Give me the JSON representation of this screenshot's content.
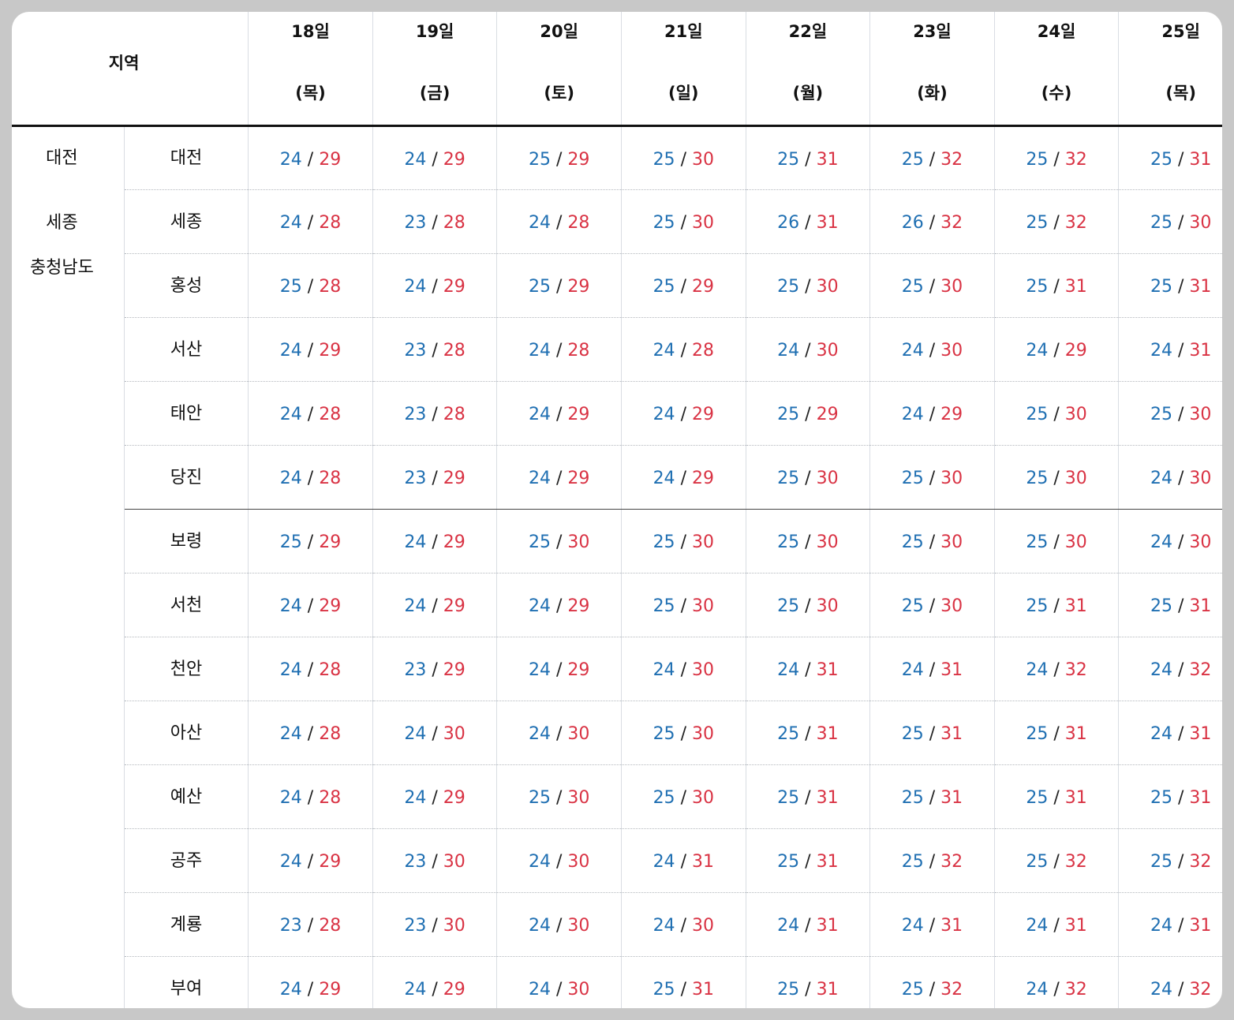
{
  "header": {
    "region_label": "지역",
    "days": [
      {
        "date": "18일",
        "dow": "(목)"
      },
      {
        "date": "19일",
        "dow": "(금)"
      },
      {
        "date": "20일",
        "dow": "(토)"
      },
      {
        "date": "21일",
        "dow": "(일)"
      },
      {
        "date": "22일",
        "dow": "(월)"
      },
      {
        "date": "23일",
        "dow": "(화)"
      },
      {
        "date": "24일",
        "dow": "(수)"
      },
      {
        "date": "25일",
        "dow": "(목)"
      }
    ]
  },
  "regions": [
    "대전",
    "세종",
    "충청남도"
  ],
  "separator": "/",
  "colors": {
    "low": "#1f6fb2",
    "high": "#d93344"
  },
  "rows": [
    {
      "city": "대전",
      "temps": [
        [
          "24",
          "29"
        ],
        [
          "24",
          "29"
        ],
        [
          "25",
          "29"
        ],
        [
          "25",
          "30"
        ],
        [
          "25",
          "31"
        ],
        [
          "25",
          "32"
        ],
        [
          "25",
          "32"
        ],
        [
          "25",
          "31"
        ]
      ]
    },
    {
      "city": "세종",
      "temps": [
        [
          "24",
          "28"
        ],
        [
          "23",
          "28"
        ],
        [
          "24",
          "28"
        ],
        [
          "25",
          "30"
        ],
        [
          "26",
          "31"
        ],
        [
          "26",
          "32"
        ],
        [
          "25",
          "32"
        ],
        [
          "25",
          "30"
        ]
      ]
    },
    {
      "city": "홍성",
      "temps": [
        [
          "25",
          "28"
        ],
        [
          "24",
          "29"
        ],
        [
          "25",
          "29"
        ],
        [
          "25",
          "29"
        ],
        [
          "25",
          "30"
        ],
        [
          "25",
          "30"
        ],
        [
          "25",
          "31"
        ],
        [
          "25",
          "31"
        ]
      ]
    },
    {
      "city": "서산",
      "temps": [
        [
          "24",
          "29"
        ],
        [
          "23",
          "28"
        ],
        [
          "24",
          "28"
        ],
        [
          "24",
          "28"
        ],
        [
          "24",
          "30"
        ],
        [
          "24",
          "30"
        ],
        [
          "24",
          "29"
        ],
        [
          "24",
          "31"
        ]
      ]
    },
    {
      "city": "태안",
      "temps": [
        [
          "24",
          "28"
        ],
        [
          "23",
          "28"
        ],
        [
          "24",
          "29"
        ],
        [
          "24",
          "29"
        ],
        [
          "25",
          "29"
        ],
        [
          "24",
          "29"
        ],
        [
          "25",
          "30"
        ],
        [
          "25",
          "30"
        ]
      ]
    },
    {
      "city": "당진",
      "temps": [
        [
          "24",
          "28"
        ],
        [
          "23",
          "29"
        ],
        [
          "24",
          "29"
        ],
        [
          "24",
          "29"
        ],
        [
          "25",
          "30"
        ],
        [
          "25",
          "30"
        ],
        [
          "25",
          "30"
        ],
        [
          "24",
          "30"
        ]
      ]
    },
    {
      "city": "보령",
      "temps": [
        [
          "25",
          "29"
        ],
        [
          "24",
          "29"
        ],
        [
          "25",
          "30"
        ],
        [
          "25",
          "30"
        ],
        [
          "25",
          "30"
        ],
        [
          "25",
          "30"
        ],
        [
          "25",
          "30"
        ],
        [
          "24",
          "30"
        ]
      ]
    },
    {
      "city": "서천",
      "temps": [
        [
          "24",
          "29"
        ],
        [
          "24",
          "29"
        ],
        [
          "24",
          "29"
        ],
        [
          "25",
          "30"
        ],
        [
          "25",
          "30"
        ],
        [
          "25",
          "30"
        ],
        [
          "25",
          "31"
        ],
        [
          "25",
          "31"
        ]
      ]
    },
    {
      "city": "천안",
      "temps": [
        [
          "24",
          "28"
        ],
        [
          "23",
          "29"
        ],
        [
          "24",
          "29"
        ],
        [
          "24",
          "30"
        ],
        [
          "24",
          "31"
        ],
        [
          "24",
          "31"
        ],
        [
          "24",
          "32"
        ],
        [
          "24",
          "32"
        ]
      ]
    },
    {
      "city": "아산",
      "temps": [
        [
          "24",
          "28"
        ],
        [
          "24",
          "30"
        ],
        [
          "24",
          "30"
        ],
        [
          "25",
          "30"
        ],
        [
          "25",
          "31"
        ],
        [
          "25",
          "31"
        ],
        [
          "25",
          "31"
        ],
        [
          "24",
          "31"
        ]
      ]
    },
    {
      "city": "예산",
      "temps": [
        [
          "24",
          "28"
        ],
        [
          "24",
          "29"
        ],
        [
          "25",
          "30"
        ],
        [
          "25",
          "30"
        ],
        [
          "25",
          "31"
        ],
        [
          "25",
          "31"
        ],
        [
          "25",
          "31"
        ],
        [
          "25",
          "31"
        ]
      ]
    },
    {
      "city": "공주",
      "temps": [
        [
          "24",
          "29"
        ],
        [
          "23",
          "30"
        ],
        [
          "24",
          "30"
        ],
        [
          "24",
          "31"
        ],
        [
          "25",
          "31"
        ],
        [
          "25",
          "32"
        ],
        [
          "25",
          "32"
        ],
        [
          "25",
          "32"
        ]
      ]
    },
    {
      "city": "계룡",
      "temps": [
        [
          "23",
          "28"
        ],
        [
          "23",
          "30"
        ],
        [
          "24",
          "30"
        ],
        [
          "24",
          "30"
        ],
        [
          "24",
          "31"
        ],
        [
          "24",
          "31"
        ],
        [
          "24",
          "31"
        ],
        [
          "24",
          "31"
        ]
      ]
    },
    {
      "city": "부여",
      "temps": [
        [
          "24",
          "29"
        ],
        [
          "24",
          "29"
        ],
        [
          "24",
          "30"
        ],
        [
          "25",
          "31"
        ],
        [
          "25",
          "31"
        ],
        [
          "25",
          "32"
        ],
        [
          "24",
          "32"
        ],
        [
          "24",
          "32"
        ]
      ]
    }
  ]
}
